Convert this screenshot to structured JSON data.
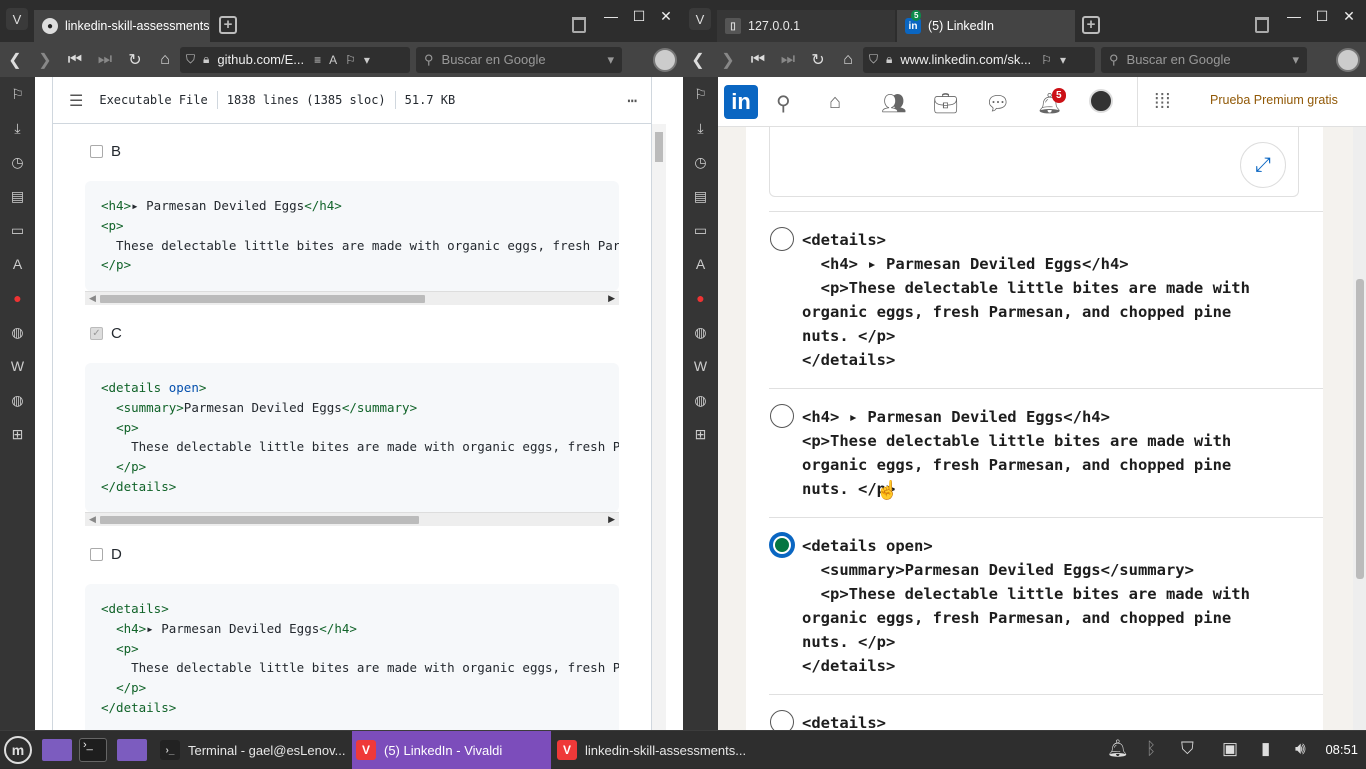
{
  "left_browser": {
    "tabs": [
      {
        "label": "linkedin-skill-assessments-"
      }
    ],
    "url": "github.com/E...",
    "search_placeholder": "Buscar en Google",
    "file_info": {
      "type": "Executable File",
      "lines": "1838 lines (1385 sloc)",
      "size": "51.7 KB"
    },
    "options": [
      {
        "letter": "B",
        "checked": false
      },
      {
        "letter": "C",
        "checked": true
      },
      {
        "letter": "D",
        "checked": false
      }
    ]
  },
  "right_browser": {
    "tabs": [
      {
        "label": "127.0.0.1"
      },
      {
        "label": "(5) LinkedIn",
        "badge": "5"
      }
    ],
    "url": "www.linkedin.com/sk...",
    "search_placeholder": "Buscar en Google",
    "nav": {
      "logo": "in",
      "notifications_badge": "5",
      "premium": "Prueba Premium gratis"
    },
    "answers": [
      {
        "selected": false
      },
      {
        "selected": false
      },
      {
        "selected": true
      },
      {
        "selected": false
      }
    ]
  },
  "taskbar": {
    "items": [
      {
        "label": "Terminal - gael@esLenov..."
      },
      {
        "label": "(5) LinkedIn - Vivaldi"
      },
      {
        "label": "linkedin-skill-assessments..."
      }
    ],
    "clock": "08:51"
  },
  "colors": {
    "linkedin_blue": "#0a66c2",
    "selected_green": "#057642",
    "taskbar_active": "#7c4dbb",
    "vivaldi_red": "#ef3939"
  }
}
